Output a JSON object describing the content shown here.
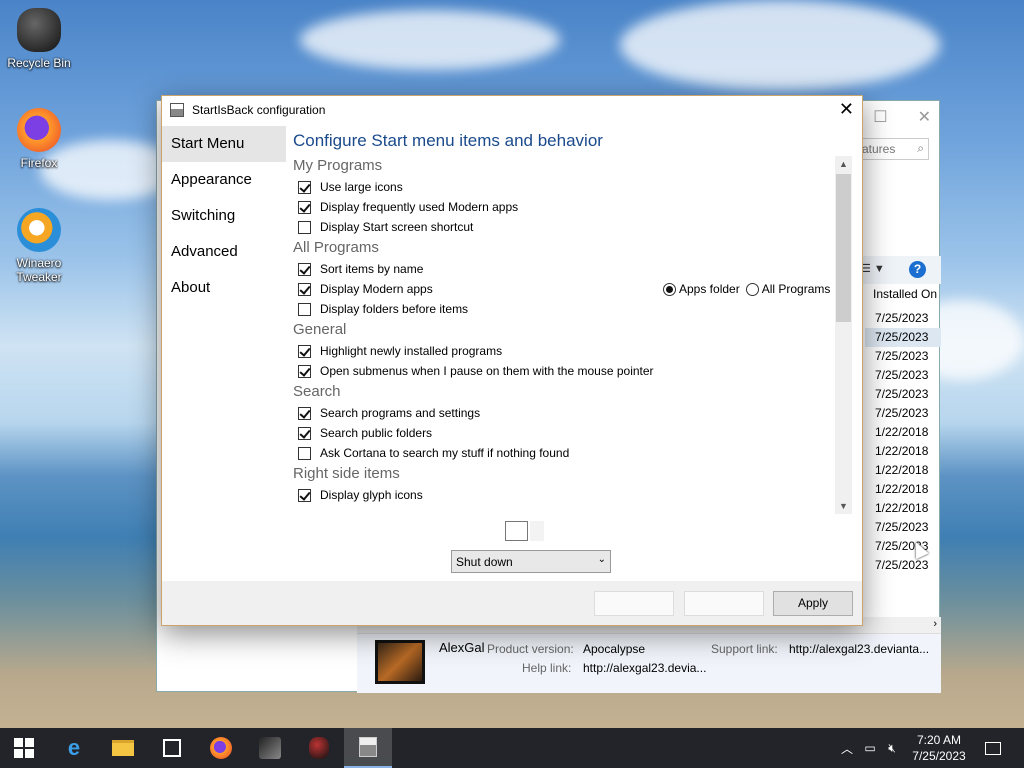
{
  "desktop": {
    "icons": [
      {
        "label": "Recycle Bin",
        "icon": "recycle-bin-icon"
      },
      {
        "label": "Firefox",
        "icon": "firefox-icon"
      },
      {
        "label": "Winaero Tweaker",
        "icon": "winaero-tweaker-icon"
      }
    ]
  },
  "back_window": {
    "search_placeholder": "atures",
    "column_header": "Installed On",
    "dates": [
      "7/25/2023",
      "7/25/2023",
      "7/25/2023",
      "7/25/2023",
      "7/25/2023",
      "7/25/2023",
      "1/22/2018",
      "1/22/2018",
      "1/22/2018",
      "1/22/2018",
      "1/22/2018",
      "7/25/2023",
      "7/25/2023",
      "7/25/2023"
    ],
    "details": {
      "publisher": "AlexGal",
      "product_version_label": "Product version:",
      "product_version": "Apocalypse",
      "support_link_label": "Support link:",
      "support_link": "http://alexgal23.devianta...",
      "help_link_label": "Help link:",
      "help_link": "http://alexgal23.devia..."
    }
  },
  "dialog": {
    "title": "StartIsBack configuration",
    "nav": [
      "Start Menu",
      "Appearance",
      "Switching",
      "Advanced",
      "About"
    ],
    "heading": "Configure Start menu items and behavior",
    "sections": {
      "my_programs": "My Programs",
      "all_programs": "All Programs",
      "general": "General",
      "search": "Search",
      "right_side": "Right side items"
    },
    "options": {
      "use_large_icons": {
        "label": "Use large icons",
        "checked": true
      },
      "frequent_modern": {
        "label": "Display frequently used Modern apps",
        "checked": true
      },
      "start_screen_shortcut": {
        "label": "Display Start screen shortcut",
        "checked": false
      },
      "sort_by_name": {
        "label": "Sort items by name",
        "checked": true
      },
      "display_modern": {
        "label": "Display Modern apps",
        "checked": true
      },
      "folders_before": {
        "label": "Display folders before items",
        "checked": false
      },
      "highlight_new": {
        "label": "Highlight newly installed programs",
        "checked": true
      },
      "open_submenus": {
        "label": "Open submenus when I pause on them with the mouse pointer",
        "checked": true
      },
      "search_programs": {
        "label": "Search programs and settings",
        "checked": true
      },
      "search_public": {
        "label": "Search public folders",
        "checked": true
      },
      "ask_cortana": {
        "label": "Ask Cortana to search my stuff if nothing found",
        "checked": false
      },
      "glyph_icons": {
        "label": "Display glyph icons",
        "checked": true
      }
    },
    "radios": {
      "apps_folder": "Apps folder",
      "all_programs": "All Programs",
      "selected": "apps_folder"
    },
    "power_dropdown": "Shut down",
    "apply_label": "Apply"
  },
  "taskbar": {
    "time": "7:20 AM",
    "date": "7/25/2023"
  }
}
